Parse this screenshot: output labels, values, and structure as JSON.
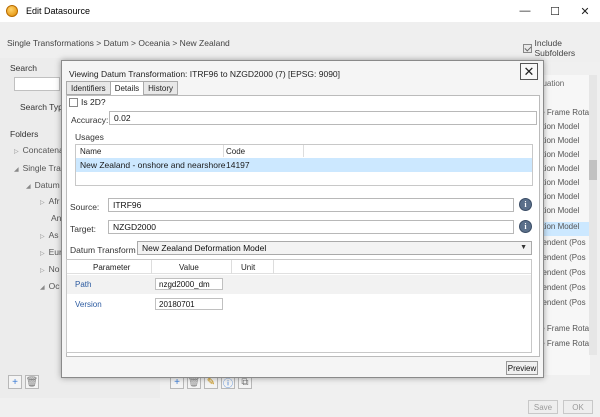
{
  "window": {
    "title": "Edit Datasource",
    "min": "—",
    "max": "☐",
    "close": "✕"
  },
  "breadcrumb": "Single Transformations >  Datum >  Oceania >  New Zealand",
  "include_subfolders": "Include Subfolders",
  "left": {
    "search_label": "Search",
    "search_type_label": "Search Type",
    "folders_label": "Folders",
    "tree": [
      "Concatena",
      "Single Tra",
      "Datum",
      "Afr",
      "An",
      "As",
      "Eur",
      "No",
      "Oc"
    ]
  },
  "right_list": {
    "header": "quation",
    "rows": [
      "te Frame Rota",
      "ation Model",
      "ation Model",
      "ation Model",
      "ation Model",
      "ation Model",
      "ation Model",
      "ation Model",
      "ation Model",
      "pendent (Pos",
      "pendent (Pos",
      "pendent (Pos",
      "pendent (Pos",
      "pendent (Pos",
      "te Frame Rota",
      "te Frame Rota"
    ]
  },
  "footer": {
    "save": "Save",
    "ok": "OK"
  },
  "dialog": {
    "title": "Viewing Datum Transformation: ITRF96 to NZGD2000 (7) [EPSG: 9090]",
    "close": "✕",
    "tabs": [
      "Identifiers",
      "Details",
      "History"
    ],
    "is2d_label": "Is 2D?",
    "accuracy_label": "Accuracy:",
    "accuracy_value": "0.02",
    "usages_label": "Usages",
    "usages_columns": [
      "Name",
      "Code"
    ],
    "usages_rows": [
      {
        "name": "New Zealand - onshore and nearshore",
        "code": "14197"
      }
    ],
    "source_label": "Source:",
    "source_value": "ITRF96",
    "target_label": "Target:",
    "target_value": "NZGD2000",
    "datum_transform_label": "Datum Transform",
    "datum_transform_value": "New Zealand Deformation Model",
    "param_columns": [
      "Parameter",
      "Value",
      "Unit"
    ],
    "params": [
      {
        "name": "Path",
        "value": "nzgd2000_dm"
      },
      {
        "name": "Version",
        "value": "20180701"
      }
    ],
    "preview": "Preview"
  },
  "colors": {
    "selection": "#cce8ff",
    "link": "#2b5aa0"
  }
}
